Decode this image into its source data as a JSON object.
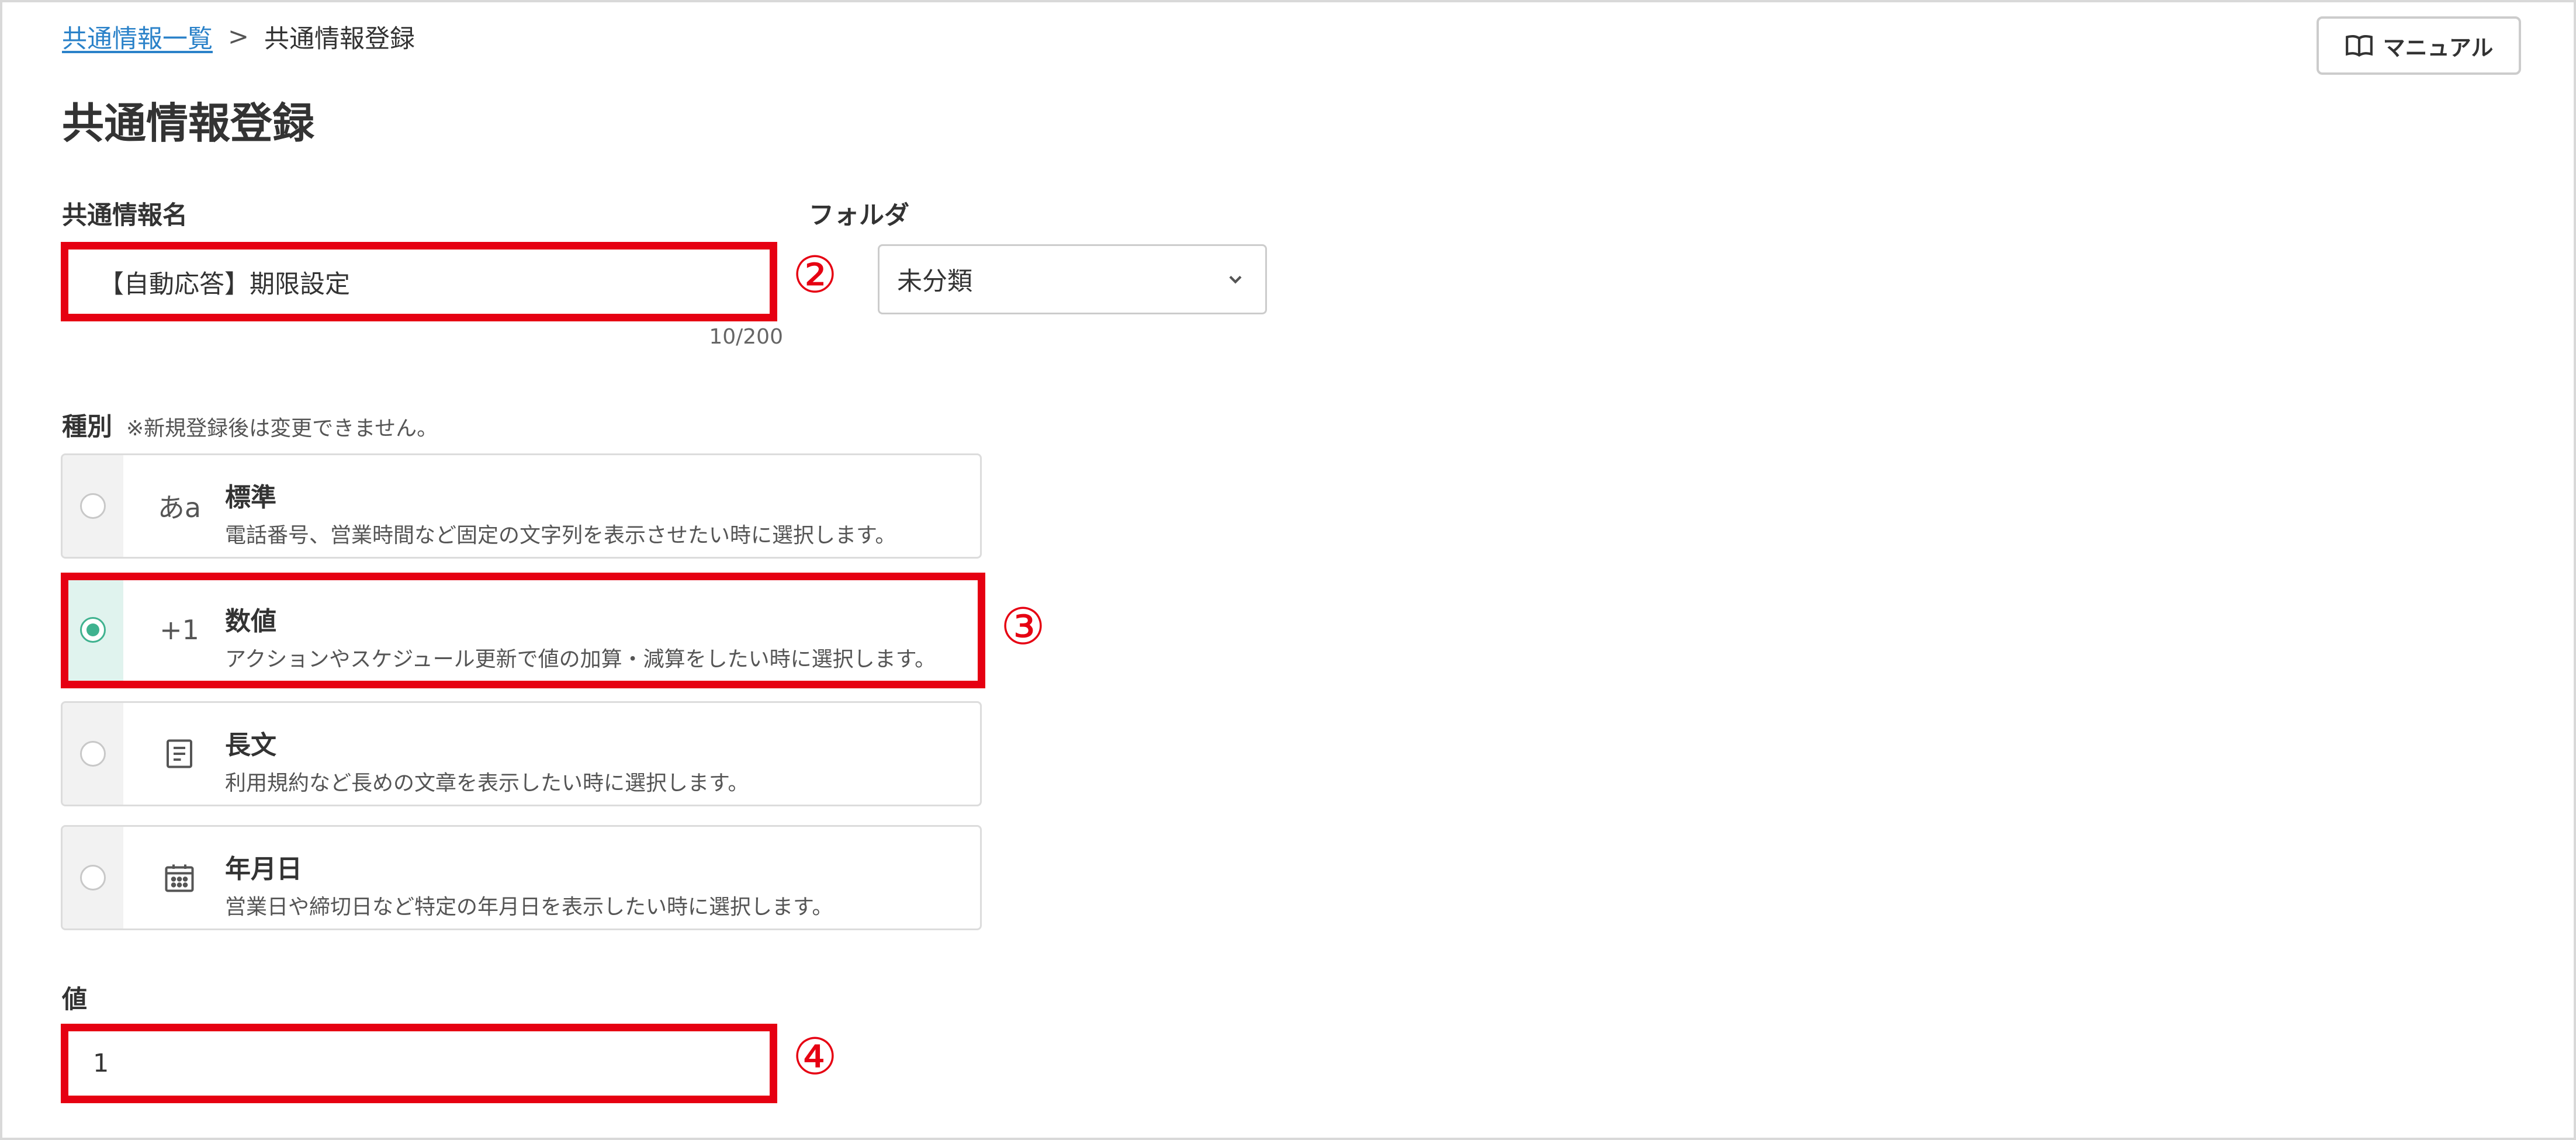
{
  "breadcrumb": {
    "parent": "共通情報一覧",
    "separator": ">",
    "current": "共通情報登録"
  },
  "header": {
    "manual_button": "マニュアル",
    "manual_icon": "book-icon"
  },
  "page_title": "共通情報登録",
  "form": {
    "name_label": "共通情報名",
    "name_value": "【自動応答】期限設定",
    "name_counter": "10/200",
    "folder_label": "フォルダ",
    "folder_value": "未分類",
    "type_label": "種別",
    "type_note": "※新規登録後は変更できません。",
    "type_options": [
      {
        "icon": "あa",
        "title": "標準",
        "desc": "電話番号、営業時間など固定の文字列を表示させたい時に選択します。",
        "selected": false
      },
      {
        "icon": "+1",
        "title": "数値",
        "desc": "アクションやスケジュール更新で値の加算・減算をしたい時に選択します。",
        "selected": true
      },
      {
        "icon": "document-icon",
        "title": "長文",
        "desc": "利用規約など長めの文章を表示したい時に選択します。",
        "selected": false
      },
      {
        "icon": "calendar-icon",
        "title": "年月日",
        "desc": "営業日や締切日など特定の年月日を表示したい時に選択します。",
        "selected": false
      }
    ],
    "value_label": "値",
    "value_value": "1"
  },
  "annotations": [
    "②",
    "③",
    "④"
  ],
  "colors": {
    "accent_green": "#3fb28f",
    "link_blue": "#2b82c9",
    "annotation_red": "#e60012"
  }
}
